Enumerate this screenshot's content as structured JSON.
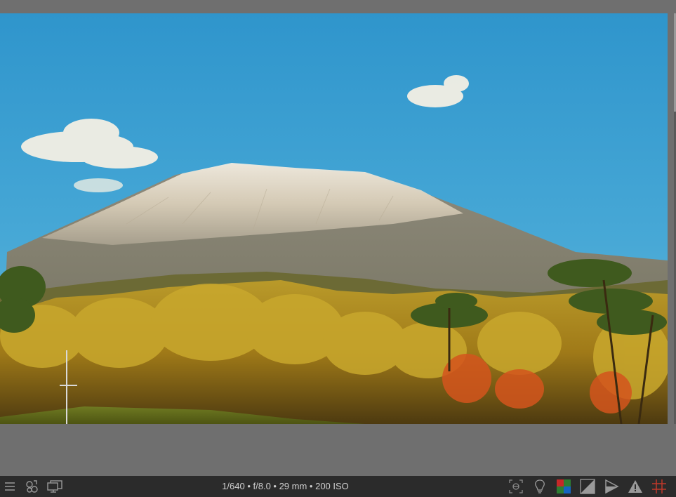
{
  "photo": {
    "description_icon": "landscape-photo"
  },
  "statusbar": {
    "exif_summary": "1/640 • f/8.0 • 29 mm • 200 ISO",
    "left_icons": [
      "menu-icon",
      "styles-icon",
      "display-icon"
    ],
    "right_icons": [
      "focus-mask-icon",
      "lightbulb-icon",
      "color-channels-icon",
      "exposure-icon",
      "clipping-icon",
      "warning-icon",
      "grid-icon"
    ],
    "colors": {
      "bar_bg": "#2b2b2b",
      "viewer_bg": "#6f6f6f",
      "icon": "#9a9a9a",
      "grid_accent": "#c0392b"
    }
  }
}
